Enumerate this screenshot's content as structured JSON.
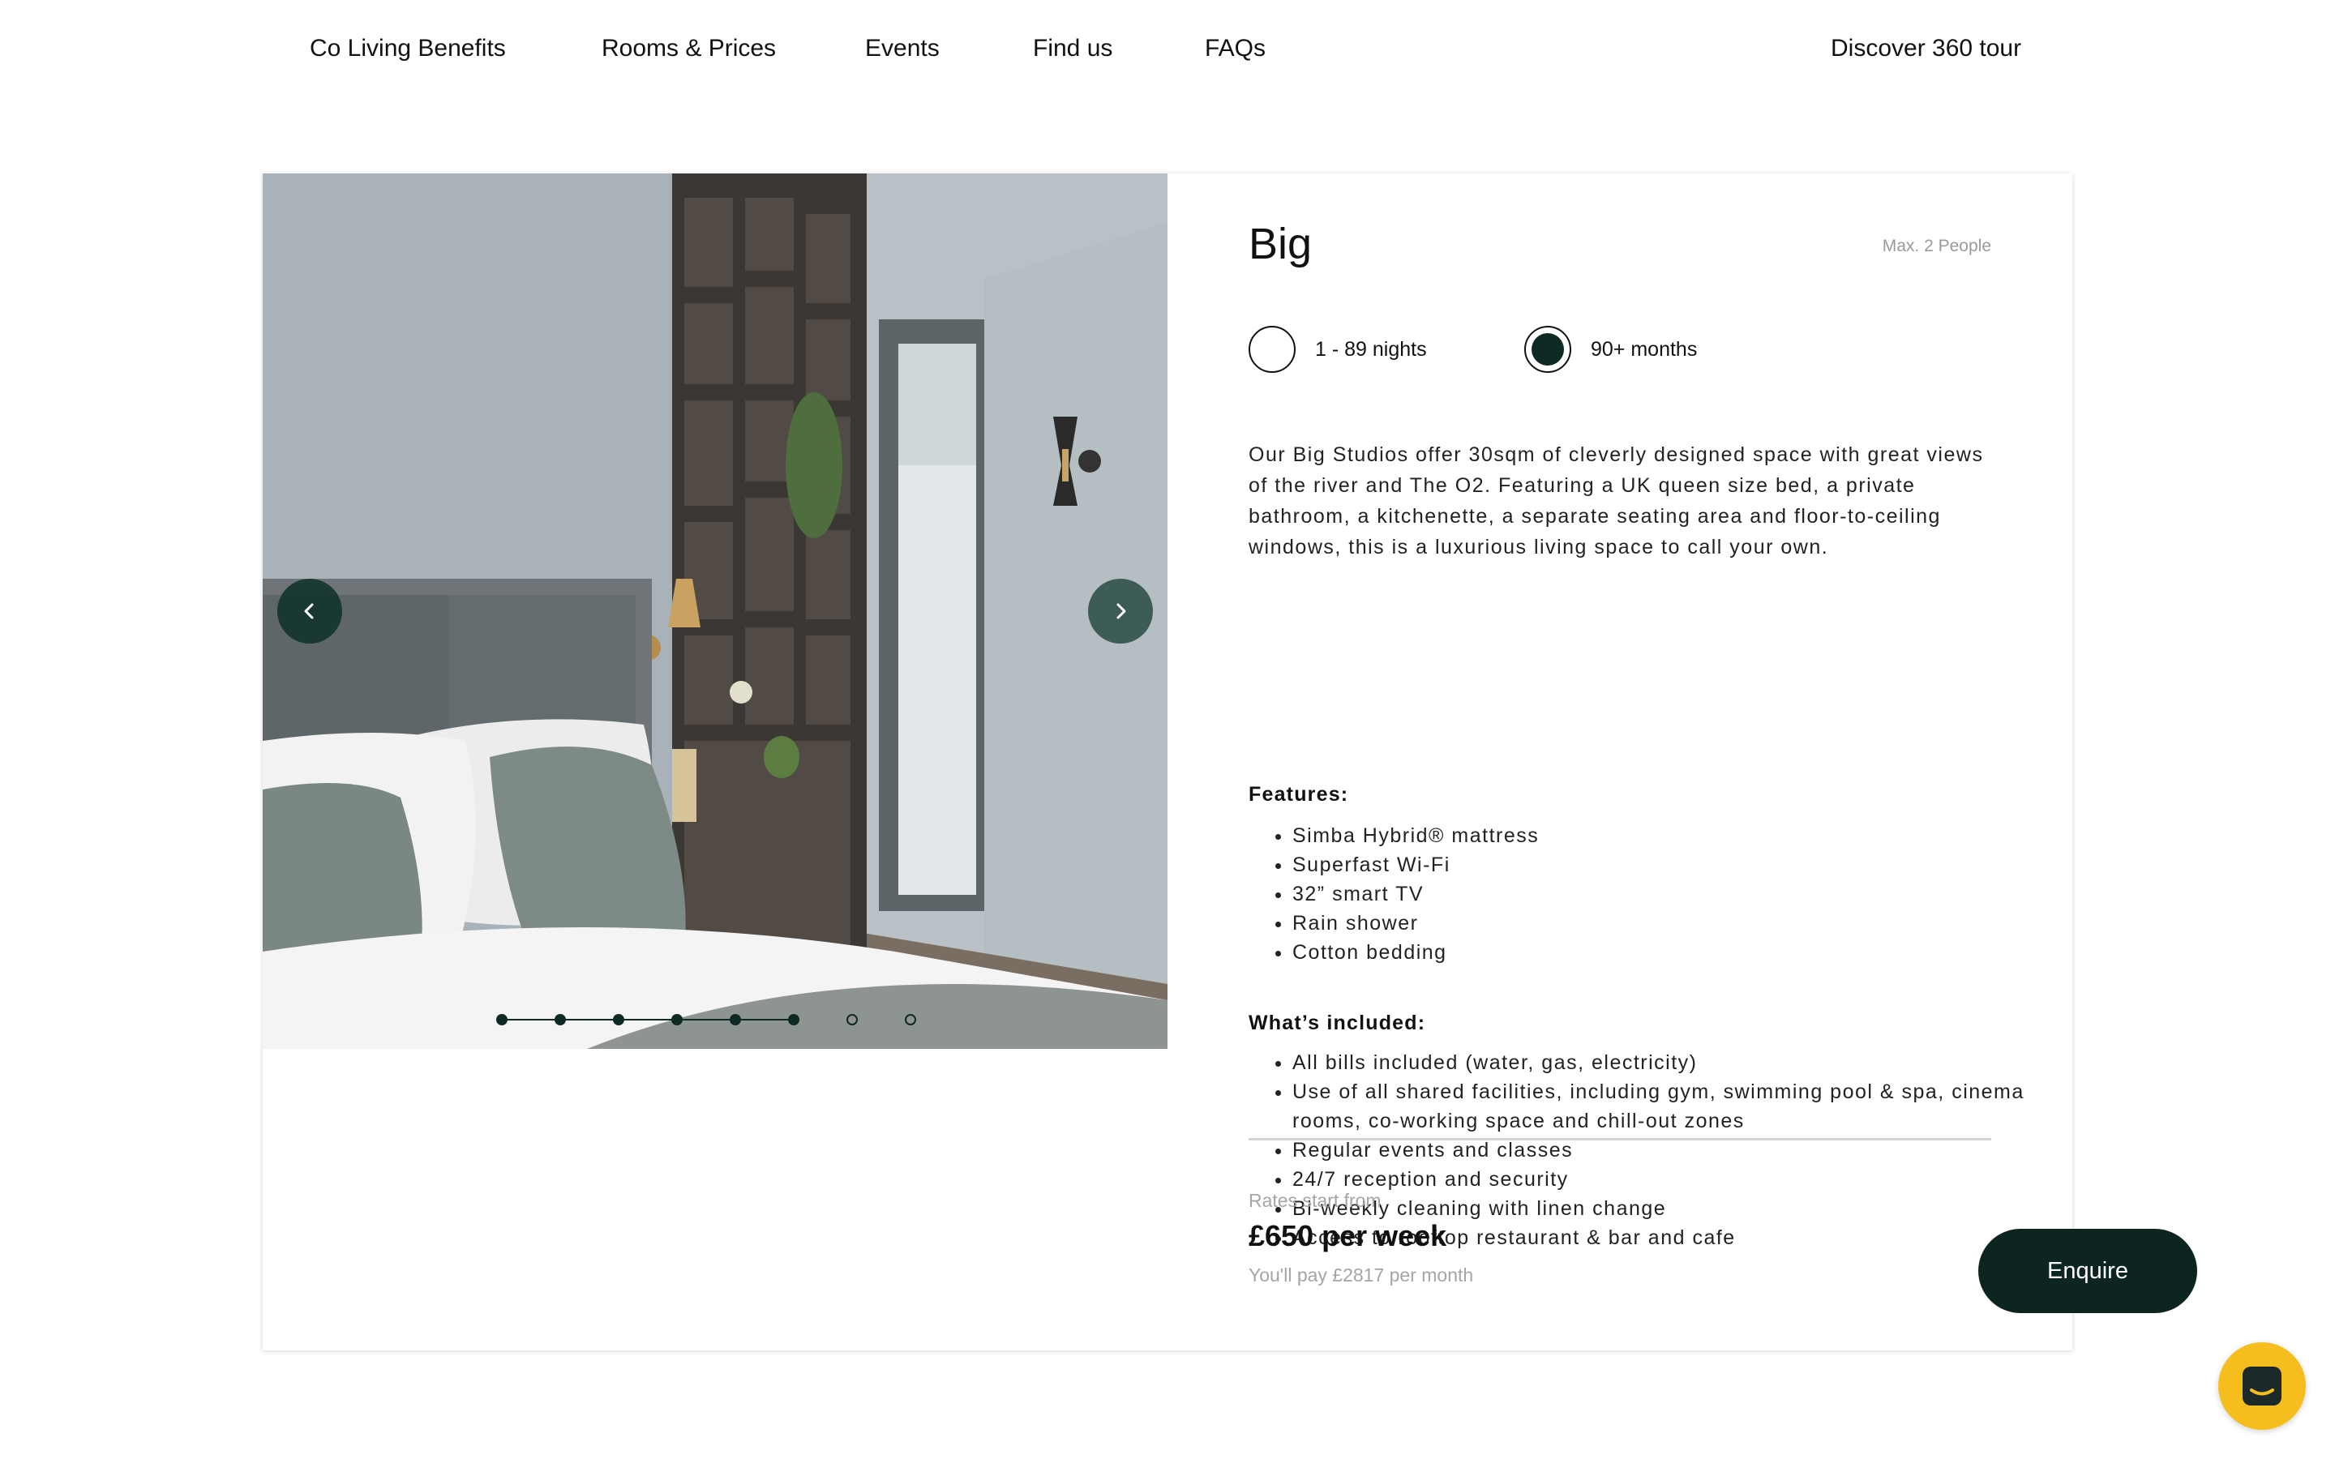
{
  "nav": {
    "items": [
      "Co Living Benefits",
      "Rooms & Prices",
      "Events",
      "Find us",
      "FAQs"
    ],
    "tour_link": "Discover 360 tour"
  },
  "gallery": {
    "prev_icon": "chevron-left-icon",
    "next_icon": "chevron-right-icon",
    "slide_count": 8,
    "active_slide": 6
  },
  "room": {
    "title": "Big",
    "capacity": "Max. 2 People",
    "stay_options": [
      {
        "label": "1 - 89 nights",
        "selected": false
      },
      {
        "label": "90+ months",
        "selected": true
      }
    ],
    "description": "Our Big Studios offer 30sqm of cleverly designed space with great views of the river and The O2. Featuring a UK queen size bed, a private bathroom, a kitchenette, a separate seating area and floor-to-ceiling windows, this is a luxurious living space to call your own.",
    "features_heading": "Features:",
    "features": [
      "Simba Hybrid® mattress",
      "Superfast Wi-Fi",
      "32” smart TV",
      "Rain shower",
      "Cotton bedding"
    ],
    "included_heading": "What’s included:",
    "included": [
      "All bills included (water, gas, electricity)",
      "Use of all shared facilities, including gym, swimming pool & spa, cinema rooms, co-working space and chill-out zones",
      "Regular events and classes",
      "24/7 reception and security",
      "Bi-weekly cleaning with linen change",
      "Access to rooftop restaurant & bar and cafe"
    ]
  },
  "pricing": {
    "rates_label": "Rates start from",
    "price": "£650 per week",
    "monthly": "You'll pay £2817 per month",
    "cta": "Enquire"
  },
  "chat": {
    "icon": "chat-icon"
  },
  "colors": {
    "accent_dark": "#0c2520",
    "chat_yellow": "#f5bd1d",
    "muted_text": "#a5a5a5"
  }
}
